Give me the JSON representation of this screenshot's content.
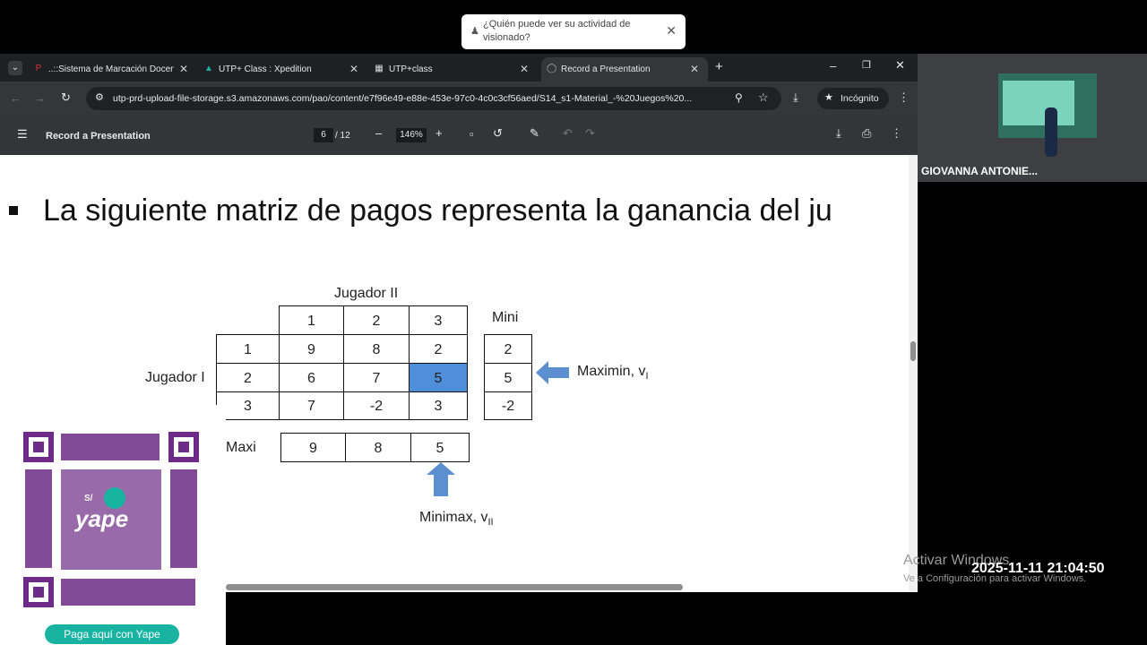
{
  "toast": {
    "text": "¿Quién puede ver su actividad de visionado?"
  },
  "tabs": [
    {
      "label": "..::Sistema de Marcación Docen",
      "icon": "utp-icon"
    },
    {
      "label": "UTP+ Class : Xpedition",
      "icon": "xpedition-icon"
    },
    {
      "label": "UTP+class",
      "icon": "class-icon"
    },
    {
      "label": "Record a Presentation",
      "icon": "globe-icon"
    }
  ],
  "address": {
    "url": "utp-prd-upload-file-storage.s3.amazonaws.com/pao/content/e7f96e49-e88e-453e-97c0-4c0c3cf56aed/S14_s1-Material_-%20Juegos%20...",
    "incognito": "Incógnito"
  },
  "pdf": {
    "title": "Record a Presentation",
    "page": "6",
    "total": "/ 12",
    "zoom": "146%"
  },
  "slide": {
    "heading": "La siguiente matriz de pagos representa la ganancia del ju",
    "jugador2": "Jugador II",
    "jugador1": "Jugador I",
    "cols": [
      "1",
      "2",
      "3"
    ],
    "rows": [
      {
        "label": "1",
        "values": [
          "9",
          "8",
          "2"
        ],
        "mini": "2"
      },
      {
        "label": "2",
        "values": [
          "6",
          "7",
          "5"
        ],
        "mini": "5"
      },
      {
        "label": "3",
        "values": [
          "7",
          "-2",
          "3"
        ],
        "mini": "-2"
      }
    ],
    "mini_label": "Mini",
    "maxi_label": "Maxi",
    "maxi": [
      "9",
      "8",
      "5"
    ],
    "maximin": "Maximin, v",
    "maximin_sub": "I",
    "minimax": "Minimax, v",
    "minimax_sub": "II"
  },
  "camera": {
    "name": "GIOVANNA ANTONIE..."
  },
  "yape": {
    "logo": "yape",
    "badge": "S/",
    "button": "Paga aquí con Yape"
  },
  "windows": {
    "line1": "Activar Windows",
    "line2": "Ve a Configuración para activar Windows."
  },
  "datetime": "2025-11-11  21:04:50"
}
